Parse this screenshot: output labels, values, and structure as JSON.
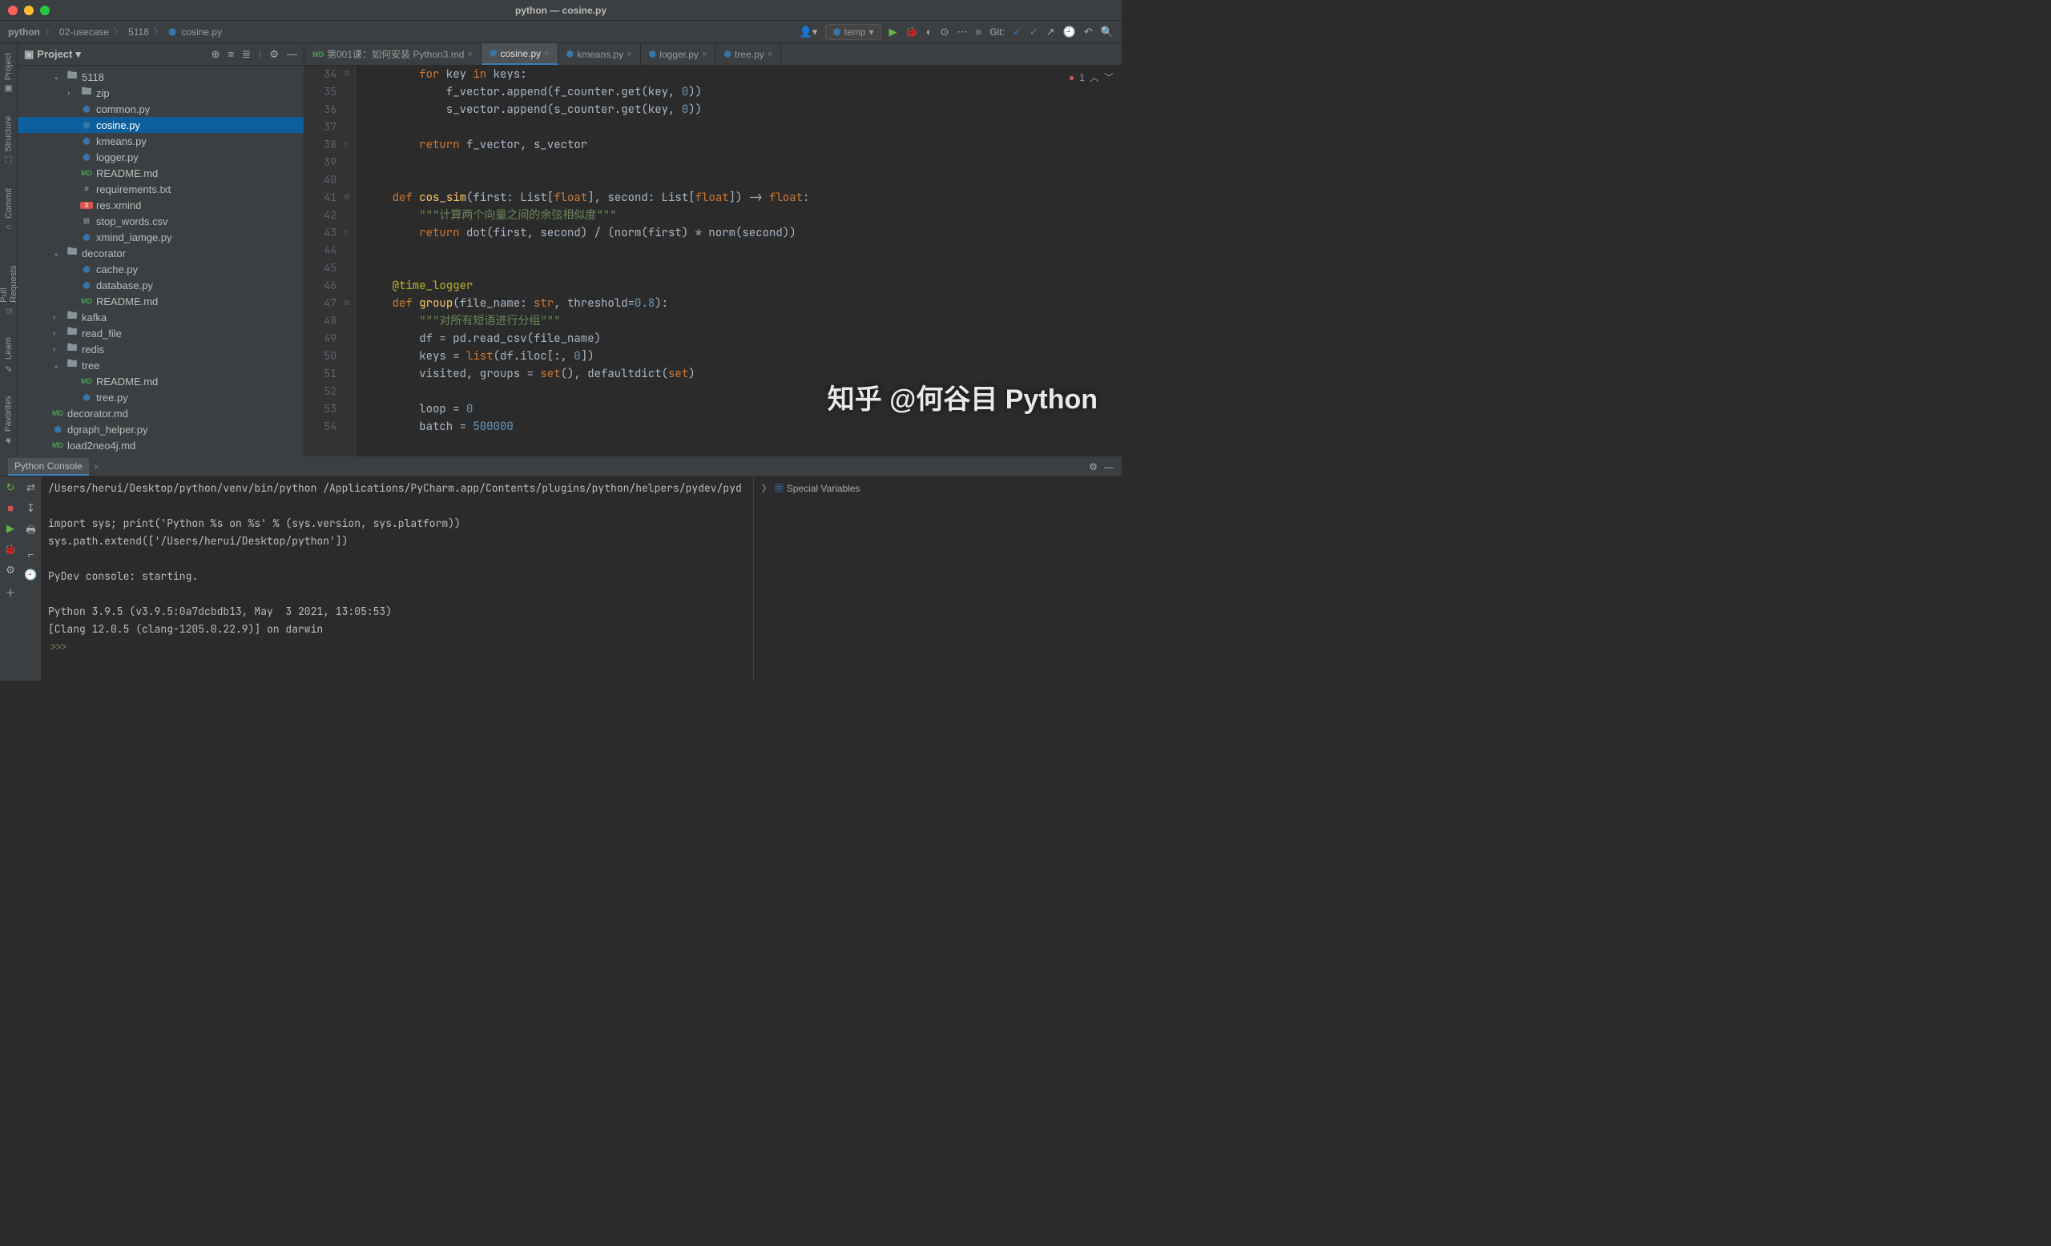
{
  "window": {
    "title": "python — cosine.py"
  },
  "breadcrumb": [
    "python",
    "02-usecase",
    "5118",
    "cosine.py"
  ],
  "run_config": {
    "label": "temp"
  },
  "git_label": "Git:",
  "left_tools": [
    "Project",
    "Structure",
    "Commit",
    "Pull Requests",
    "Learn",
    "Favorites"
  ],
  "project_panel": {
    "title": "Project"
  },
  "tree": [
    {
      "depth": 2,
      "chev": "v",
      "icon": "folder",
      "label": "5118"
    },
    {
      "depth": 3,
      "chev": ">",
      "icon": "folder",
      "label": "zip"
    },
    {
      "depth": 3,
      "chev": "",
      "icon": "py",
      "label": "common.py"
    },
    {
      "depth": 3,
      "chev": "",
      "icon": "py",
      "label": "cosine.py",
      "selected": true
    },
    {
      "depth": 3,
      "chev": "",
      "icon": "py",
      "label": "kmeans.py"
    },
    {
      "depth": 3,
      "chev": "",
      "icon": "py",
      "label": "logger.py"
    },
    {
      "depth": 3,
      "chev": "",
      "icon": "md",
      "label": "README.md"
    },
    {
      "depth": 3,
      "chev": "",
      "icon": "txt",
      "label": "requirements.txt"
    },
    {
      "depth": 3,
      "chev": "",
      "icon": "xmind",
      "label": "res.xmind"
    },
    {
      "depth": 3,
      "chev": "",
      "icon": "csv",
      "label": "stop_words.csv"
    },
    {
      "depth": 3,
      "chev": "",
      "icon": "py",
      "label": "xmind_iamge.py"
    },
    {
      "depth": 2,
      "chev": "v",
      "icon": "folder",
      "label": "decorator"
    },
    {
      "depth": 3,
      "chev": "",
      "icon": "py",
      "label": "cache.py"
    },
    {
      "depth": 3,
      "chev": "",
      "icon": "py",
      "label": "database.py"
    },
    {
      "depth": 3,
      "chev": "",
      "icon": "md",
      "label": "README.md"
    },
    {
      "depth": 2,
      "chev": ">",
      "icon": "folder",
      "label": "kafka"
    },
    {
      "depth": 2,
      "chev": ">",
      "icon": "folder",
      "label": "read_file"
    },
    {
      "depth": 2,
      "chev": ">",
      "icon": "folder",
      "label": "redis"
    },
    {
      "depth": 2,
      "chev": "v",
      "icon": "folder",
      "label": "tree"
    },
    {
      "depth": 3,
      "chev": "",
      "icon": "md",
      "label": "README.md"
    },
    {
      "depth": 3,
      "chev": "",
      "icon": "py",
      "label": "tree.py"
    },
    {
      "depth": 1,
      "chev": "",
      "icon": "md",
      "label": "decorator.md"
    },
    {
      "depth": 1,
      "chev": "",
      "icon": "py",
      "label": "dgraph_helper.py"
    },
    {
      "depth": 1,
      "chev": "",
      "icon": "md",
      "label": "load2neo4j.md"
    }
  ],
  "tabs": [
    {
      "icon": "md",
      "label": "第001课：如何安装 Python3.md"
    },
    {
      "icon": "py",
      "label": "cosine.py",
      "active": true
    },
    {
      "icon": "py",
      "label": "kmeans.py"
    },
    {
      "icon": "py",
      "label": "logger.py"
    },
    {
      "icon": "py",
      "label": "tree.py"
    }
  ],
  "editor_markers": {
    "errors": "1"
  },
  "line_start": 34,
  "line_end": 54,
  "code_lines": [
    {
      "n": 34,
      "html": "        <span class='kw'>for</span> key <span class='kw'>in</span> keys:"
    },
    {
      "n": 35,
      "html": "            f_vector.append(f_counter.get(key, <span class='num'>0</span>))"
    },
    {
      "n": 36,
      "html": "            s_vector.append(s_counter.get(key, <span class='num'>0</span>))"
    },
    {
      "n": 37,
      "html": ""
    },
    {
      "n": 38,
      "html": "        <span class='kw'>return</span> f_vector, s_vector"
    },
    {
      "n": 39,
      "html": ""
    },
    {
      "n": 40,
      "html": ""
    },
    {
      "n": 41,
      "html": "    <span class='kw'>def</span> <span class='fn'>cos_sim</span>(first: List[<span class='builtin'>float</span>], second: List[<span class='builtin'>float</span>]) -> <span class='builtin'>float</span>:"
    },
    {
      "n": 42,
      "html": "        <span class='str'>\"\"\"计算两个向量之间的余弦相似度\"\"\"</span>"
    },
    {
      "n": 43,
      "html": "        <span class='kw'>return</span> dot(first, second) / (norm(first) * norm(second))"
    },
    {
      "n": 44,
      "html": ""
    },
    {
      "n": 45,
      "html": ""
    },
    {
      "n": 46,
      "html": "    <span class='deco'>@time_logger</span>"
    },
    {
      "n": 47,
      "html": "    <span class='kw'>def</span> <span class='fn'>group</span>(file_name: <span class='builtin'>str</span>, threshold=<span class='num'>0.8</span>):"
    },
    {
      "n": 48,
      "html": "        <span class='str'>\"\"\"对所有短语进行分组\"\"\"</span>"
    },
    {
      "n": 49,
      "html": "        df = pd.read_csv(file_name)"
    },
    {
      "n": 50,
      "html": "        keys = <span class='builtin'>list</span>(df.iloc[:, <span class='num'>0</span>])"
    },
    {
      "n": 51,
      "html": "        visited, groups = <span class='builtin'>set</span>(), defaultdict(<span class='builtin'>set</span>)"
    },
    {
      "n": 52,
      "html": ""
    },
    {
      "n": 53,
      "html": "        loop = <span class='num'>0</span>"
    },
    {
      "n": 54,
      "html": "        batch = <span class='num'>500000</span>"
    }
  ],
  "console": {
    "tab": "Python Console",
    "vars_label": "Special Variables",
    "lines": [
      "/Users/herui/Desktop/python/venv/bin/python /Applications/PyCharm.app/Contents/plugins/python/helpers/pydev/pyd",
      "",
      "import sys; print('Python %s on %s' % (sys.version, sys.platform))",
      "sys.path.extend(['/Users/herui/Desktop/python'])",
      "",
      "PyDev console: starting.",
      "",
      "Python 3.9.5 (v3.9.5:0a7dcbdb13, May  3 2021, 13:05:53)",
      "[Clang 12.0.5 (clang-1205.0.22.9)] on darwin"
    ],
    "prompt": ">>>"
  },
  "watermark": "知乎 @何谷目 Python"
}
